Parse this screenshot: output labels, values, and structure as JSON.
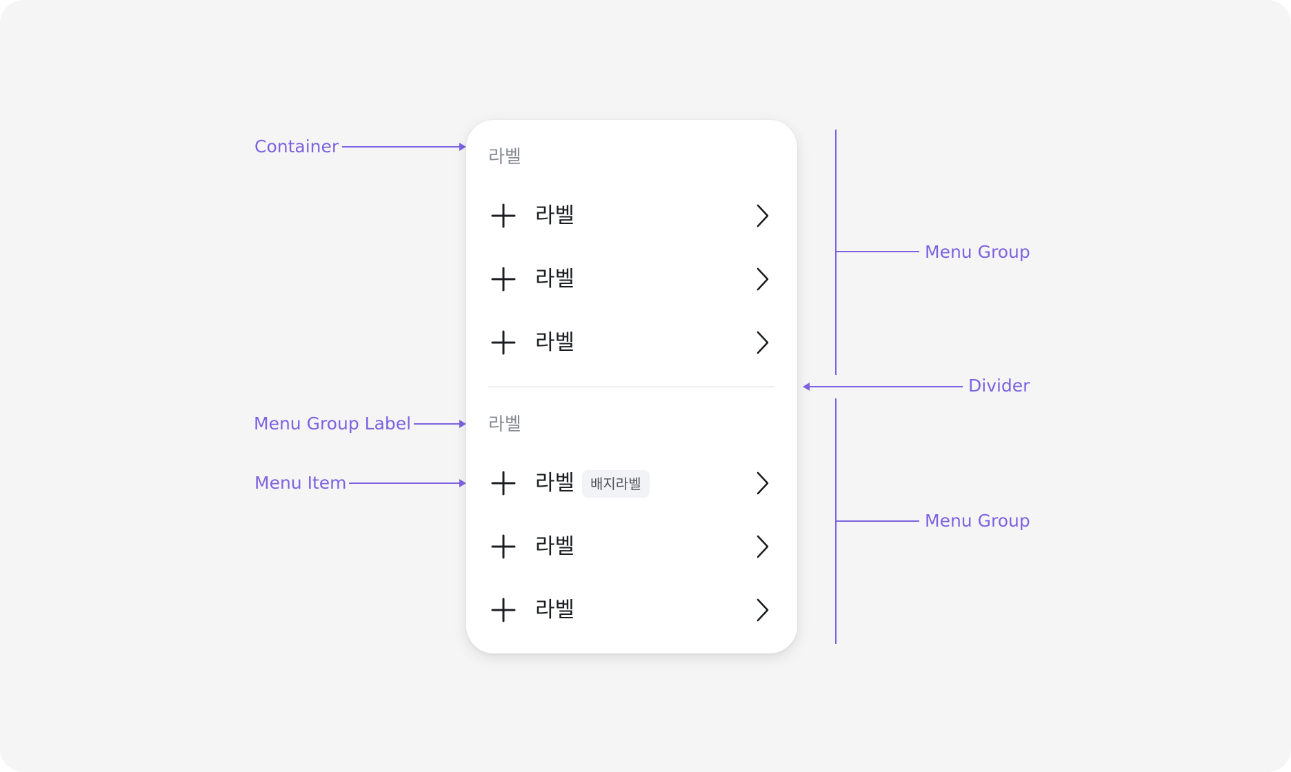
{
  "annotations": {
    "container": "Container",
    "menu_group_top": "Menu Group",
    "divider": "Divider",
    "menu_group_label": "Menu Group Label",
    "menu_item": "Menu Item",
    "menu_group_bottom": "Menu Group"
  },
  "menu": {
    "groups": [
      {
        "label": "라벨",
        "items": [
          {
            "icon": "plus-icon",
            "label": "라벨",
            "trailing_icon": "chevron-right-icon"
          },
          {
            "icon": "plus-icon",
            "label": "라벨",
            "trailing_icon": "chevron-right-icon"
          },
          {
            "icon": "plus-icon",
            "label": "라벨",
            "trailing_icon": "chevron-right-icon"
          }
        ]
      },
      {
        "label": "라벨",
        "items": [
          {
            "icon": "plus-icon",
            "label": "라벨",
            "badge": "배지라벨",
            "trailing_icon": "chevron-right-icon"
          },
          {
            "icon": "plus-icon",
            "label": "라벨",
            "trailing_icon": "chevron-right-icon"
          },
          {
            "icon": "plus-icon",
            "label": "라벨",
            "trailing_icon": "chevron-right-icon"
          }
        ]
      }
    ]
  },
  "colors": {
    "background": "#f5f5f5",
    "annotation": "#7d62e0",
    "card": "#ffffff",
    "group_label": "#868b94",
    "item_label": "#1a1c20",
    "badge_bg": "#f2f3f6",
    "badge_text": "#4d5159",
    "divider": "#eceef1"
  }
}
